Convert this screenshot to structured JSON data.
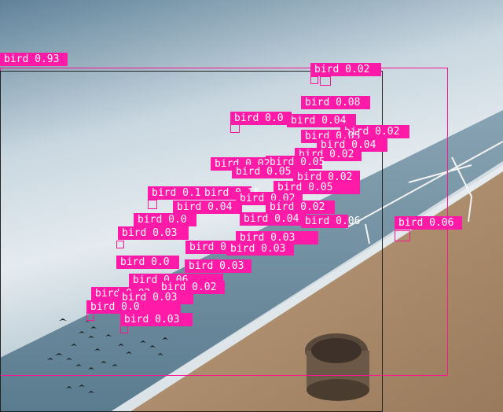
{
  "image": {
    "subject": "beach-with-birds",
    "colors": {
      "sky_top": "#6f90a6",
      "sky_mid": "#d8e3ea",
      "sea": "#6e8fa1",
      "sand": "#b09070",
      "detection_box": "#ff1493",
      "label_bg": "#ff1aa8",
      "label_text": "#ffffff"
    }
  },
  "detections": [
    {
      "label": "bird 0.93"
    },
    {
      "label": "bird 0.02"
    },
    {
      "label": "bird 0.08"
    },
    {
      "label": "bird 0.0"
    },
    {
      "label": "bird 0.04"
    },
    {
      "label": "bird 0.02"
    },
    {
      "label": "bird 0.05"
    },
    {
      "label": "bird 0.04"
    },
    {
      "label": "bird 0.02"
    },
    {
      "label": "bird 0.05"
    },
    {
      "label": "bird 0.02"
    },
    {
      "label": "bird 0.05"
    },
    {
      "label": "bird 0.15"
    },
    {
      "label": "bird 0.04"
    },
    {
      "label": "bird 0.02"
    },
    {
      "label": "bird 0.04"
    },
    {
      "label": "bird 0.06"
    },
    {
      "label": "bird 0.06"
    },
    {
      "label": "bird 0.03"
    },
    {
      "label": "bird 0.03"
    },
    {
      "label": "bird 0.03"
    },
    {
      "label": "bird 0.02"
    },
    {
      "label": "bird 0.03"
    },
    {
      "label": "bird 0.03"
    },
    {
      "label": "bird 0.03"
    }
  ]
}
